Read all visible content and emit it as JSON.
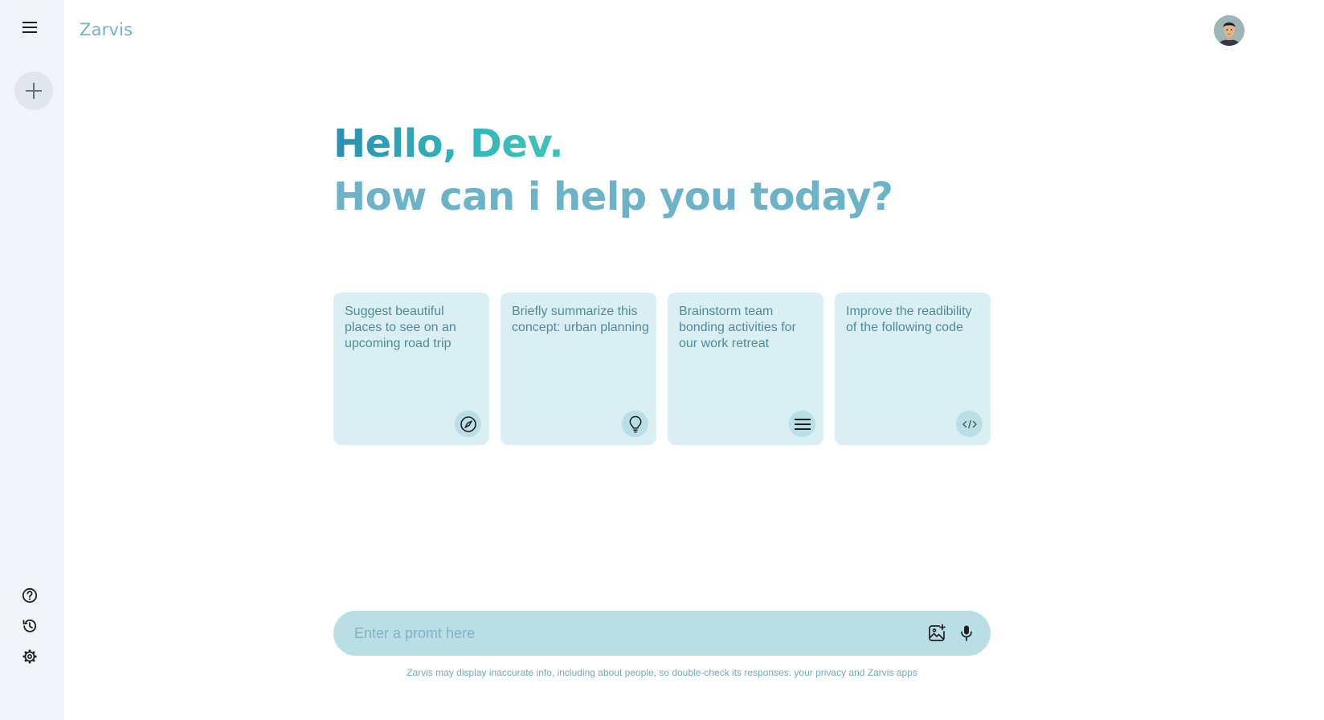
{
  "app": {
    "brand": "Zarvis"
  },
  "colors": {
    "sidebar_bg": "#f0f4f9",
    "accent": "#6cb3c8",
    "card_bg": "#d9eff2",
    "input_bg": "#b9dfe5"
  },
  "sidebar": {
    "top_icons": [
      "menu-icon",
      "plus-icon"
    ],
    "bottom_icons": [
      "help-icon",
      "history-icon",
      "settings-icon"
    ]
  },
  "header": {
    "avatar_icon": "user-avatar"
  },
  "main": {
    "greeting": "Hello, Dev.",
    "subgreeting": "How can i help you today?",
    "cards": [
      {
        "text": "Suggest beautiful places to see on an upcoming road trip",
        "icon": "compass-icon"
      },
      {
        "text": "Briefly summarize this concept: urban planning",
        "icon": "lightbulb-icon"
      },
      {
        "text": "Brainstorm team bonding activities for our work retreat",
        "icon": "list-icon"
      },
      {
        "text": "Improve the readibility of the following code",
        "icon": "code-icon"
      }
    ]
  },
  "prompt": {
    "placeholder": "Enter a promt here",
    "value": "",
    "icons": [
      "add-image-icon",
      "mic-icon"
    ]
  },
  "footer": {
    "disclaimer": "Zarvis may display inaccurate info, including about people, so double-check its responses. your privacy and Zarvis apps"
  }
}
